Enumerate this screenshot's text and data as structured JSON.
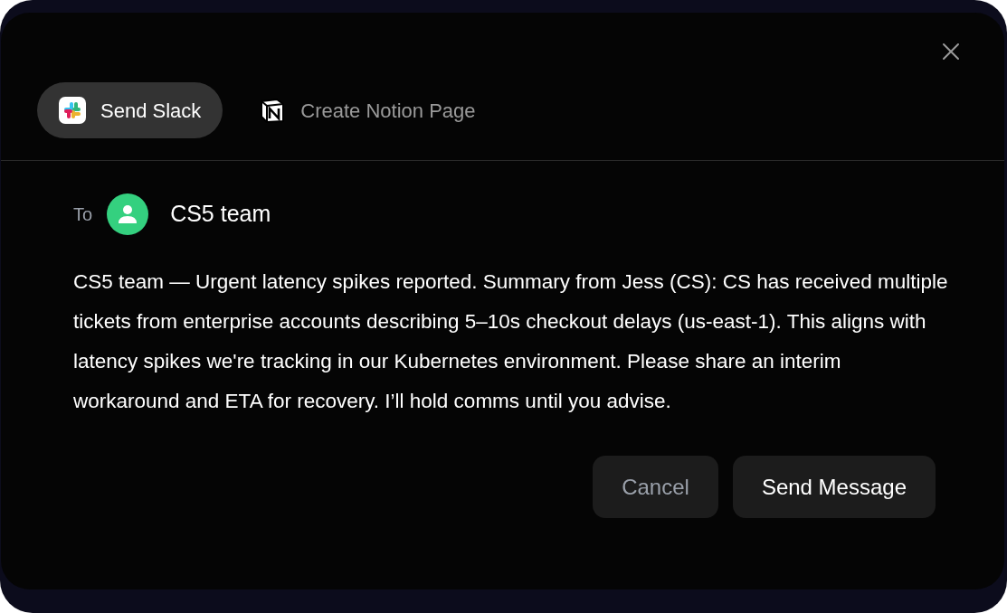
{
  "tabs": [
    {
      "label": "Send Slack",
      "kind": "slack",
      "selected": true
    },
    {
      "label": "Create Notion Page",
      "kind": "notion",
      "selected": false
    }
  ],
  "recipient": {
    "label": "To",
    "name": "CS5 team"
  },
  "message": "CS5 team — Urgent latency spikes reported. Summary from Jess (CS): CS has received multiple tickets from enterprise accounts describing 5–10s checkout delays (us-east-1). This aligns with latency spikes we're tracking in our Kubernetes environment. Please share an interim workaround and ETA for recovery. I’ll hold comms until you advise.",
  "buttons": [
    {
      "label": "Cancel",
      "kind": "secondary"
    },
    {
      "label": "Send Message",
      "kind": "primary"
    }
  ]
}
